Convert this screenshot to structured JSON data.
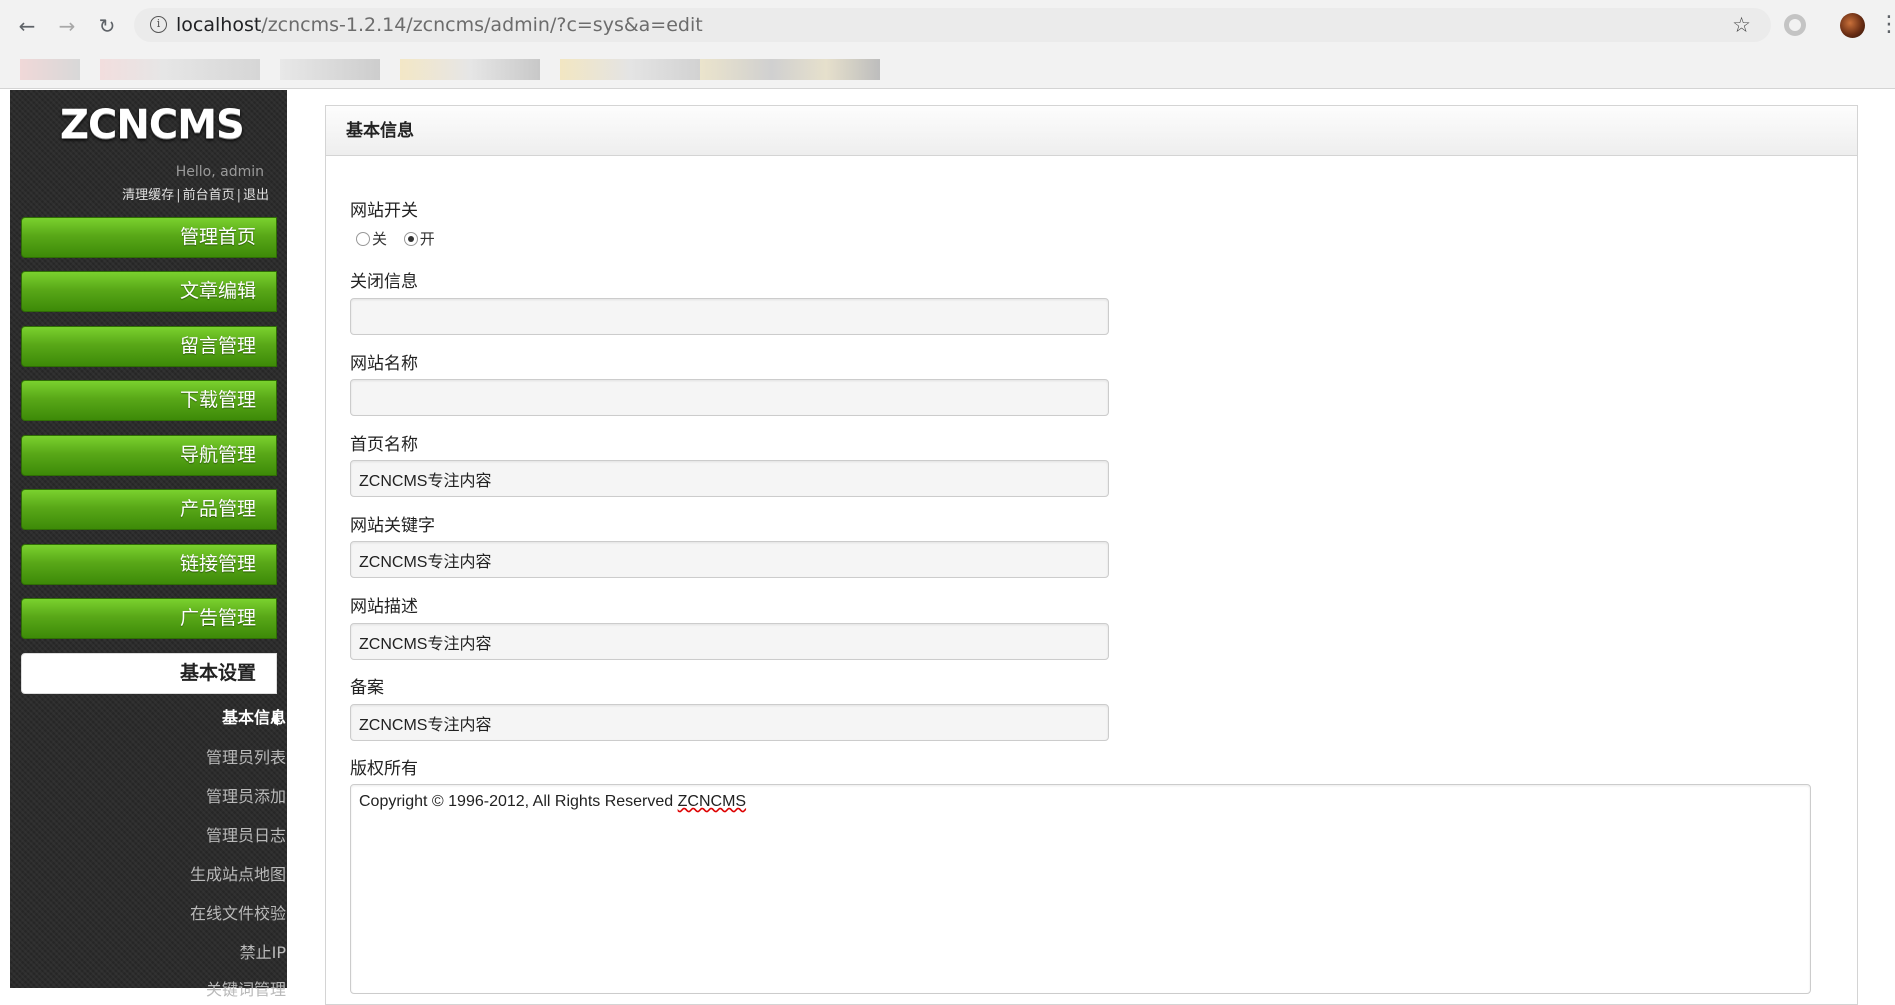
{
  "browser": {
    "url_host": "localhost",
    "url_path": "/zcncms-1.2.14/zcncms/admin/?c=sys&a=edit",
    "info_icon": "i",
    "back_icon": "←",
    "forward_icon": "→",
    "reload_icon": "↻",
    "star_icon": "☆",
    "menu_icon": "⋮"
  },
  "sidebar": {
    "logo": "ZCNCMS",
    "greeting": "Hello, admin",
    "user_links": {
      "clear_cache": "清理缓存",
      "frontend": "前台首页",
      "logout": "退出",
      "separator": "|"
    },
    "menu": [
      {
        "label": "管理首页"
      },
      {
        "label": "文章编辑"
      },
      {
        "label": "留言管理"
      },
      {
        "label": "下载管理"
      },
      {
        "label": "导航管理"
      },
      {
        "label": "产品管理"
      },
      {
        "label": "链接管理"
      },
      {
        "label": "广告管理"
      },
      {
        "label": "基本设置"
      }
    ],
    "submenu": [
      {
        "label": "基本信息"
      },
      {
        "label": "管理员列表"
      },
      {
        "label": "管理员添加"
      },
      {
        "label": "管理员日志"
      },
      {
        "label": "生成站点地图"
      },
      {
        "label": "在线文件校验"
      },
      {
        "label": "禁止IP"
      },
      {
        "label": "关键词管理"
      }
    ]
  },
  "panel": {
    "title": "基本信息",
    "site_switch": {
      "label": "网站开关",
      "options": [
        "关",
        "开"
      ],
      "selected": "开"
    },
    "close_message": {
      "label": "关闭信息",
      "value": ""
    },
    "site_name": {
      "label": "网站名称",
      "value": ""
    },
    "home_name": {
      "label": "首页名称",
      "value": "ZCNCMS专注内容"
    },
    "keywords": {
      "label": "网站关键字",
      "value": "ZCNCMS专注内容"
    },
    "description": {
      "label": "网站描述",
      "value": "ZCNCMS专注内容"
    },
    "icp": {
      "label": "备案",
      "value": "ZCNCMS专注内容"
    },
    "copyright": {
      "label": "版权所有",
      "prefix": "Copyright © 1996-2012, All Rights Reserved ",
      "brand": "ZCNCMS"
    }
  }
}
